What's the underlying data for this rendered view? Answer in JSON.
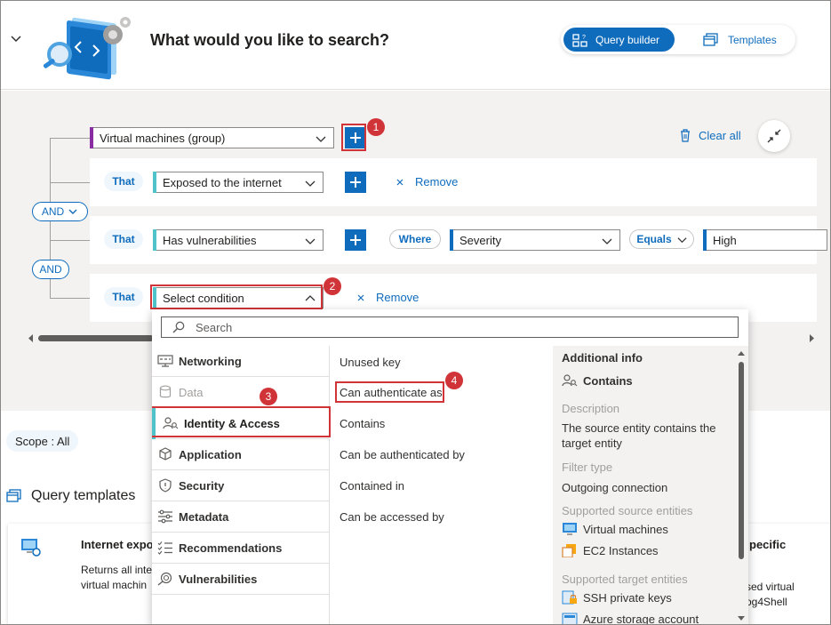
{
  "header": {
    "title": "What would you like to search?",
    "query_builder_label": "Query builder",
    "templates_label": "Templates"
  },
  "builder": {
    "clear_all_label": "Clear all",
    "and_label_1": "AND",
    "and_label_2": "AND",
    "root": {
      "value": "Virtual machines (group)",
      "accent": "#8a2da5"
    },
    "rows": [
      {
        "that": "That",
        "condition": "Exposed to the internet",
        "remove": "Remove"
      },
      {
        "that": "That",
        "condition": "Has vulnerabilities",
        "where": "Where",
        "property": "Severity",
        "operator": "Equals",
        "value": "High"
      },
      {
        "that": "That",
        "condition": "Select condition",
        "remove": "Remove"
      }
    ],
    "accent_color": "#4fc3c9"
  },
  "callouts": [
    "1",
    "2",
    "3",
    "4"
  ],
  "popup": {
    "search_placeholder": "Search",
    "categories": [
      {
        "label": "Networking",
        "icon": "networking-icon",
        "state": "normal"
      },
      {
        "label": "Data",
        "icon": "database-icon",
        "state": "disabled"
      },
      {
        "label": "Identity & Access",
        "icon": "identity-icon",
        "state": "selected"
      },
      {
        "label": "Application",
        "icon": "application-icon",
        "state": "normal"
      },
      {
        "label": "Security",
        "icon": "shield-icon",
        "state": "normal"
      },
      {
        "label": "Metadata",
        "icon": "metadata-icon",
        "state": "normal"
      },
      {
        "label": "Recommendations",
        "icon": "recommendations-icon",
        "state": "normal"
      },
      {
        "label": "Vulnerabilities",
        "icon": "vulnerabilities-icon",
        "state": "normal"
      }
    ],
    "relations": [
      "Unused key",
      "Can authenticate as",
      "Contains",
      "Can be authenticated by",
      "Contained in",
      "Can be accessed by"
    ],
    "info": {
      "heading": "Additional info",
      "relation_name": "Contains",
      "description_label": "Description",
      "description": "The source entity contains the target entity",
      "filter_type_label": "Filter type",
      "filter_type": "Outgoing connection",
      "source_label": "Supported source entities",
      "source_entities": [
        "Virtual machines",
        "EC2 Instances"
      ],
      "target_label": "Supported target entities",
      "target_entities": [
        "SSH private keys",
        "Azure storage account"
      ]
    }
  },
  "scope": {
    "label": "Scope : All"
  },
  "templates": {
    "title": "Query templates",
    "card1": {
      "title": "Internet expo",
      "line1": "Returns all inte",
      "line2": "virtual machin"
    },
    "card2": {
      "title": "pecific",
      "line1": "sed virtual",
      "line2": "og4Shell"
    }
  }
}
